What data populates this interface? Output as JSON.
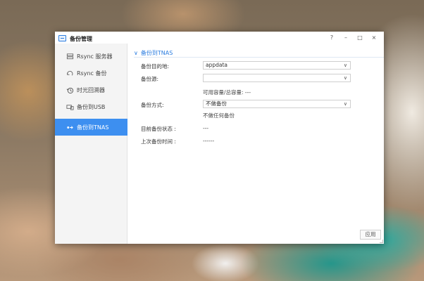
{
  "window": {
    "title": "备份管理",
    "controls": {
      "help": "?",
      "minimize": "–",
      "maximize": "□",
      "close": "×"
    }
  },
  "sidebar": {
    "items": [
      {
        "label": "Rsync 服务器",
        "icon": "rsync-server-icon",
        "active": false
      },
      {
        "label": "Rsync 备份",
        "icon": "rsync-backup-icon",
        "active": false
      },
      {
        "label": "时光回溯器",
        "icon": "time-machine-icon",
        "active": false
      },
      {
        "label": "备份到USB",
        "icon": "usb-backup-icon",
        "active": false
      },
      {
        "label": "备份到TNAS",
        "icon": "tnas-backup-icon",
        "active": true
      }
    ]
  },
  "main": {
    "section_title": "备份到TNAS",
    "form": {
      "destination_label": "备份目的地:",
      "destination_value": "appdata",
      "source_label": "备份源:",
      "source_value": "",
      "capacity_text": "可用容量/总容量: ---",
      "method_label": "备份方式:",
      "method_value": "不做备份",
      "method_desc": "不做任何备份",
      "status_label": "目前备份状态 :",
      "status_value": "---",
      "last_time_label": "上次备份时间 :",
      "last_time_value": "------"
    },
    "apply_label": "应用"
  },
  "colors": {
    "accent": "#3d8ff0",
    "header_text": "#2b7de0"
  }
}
